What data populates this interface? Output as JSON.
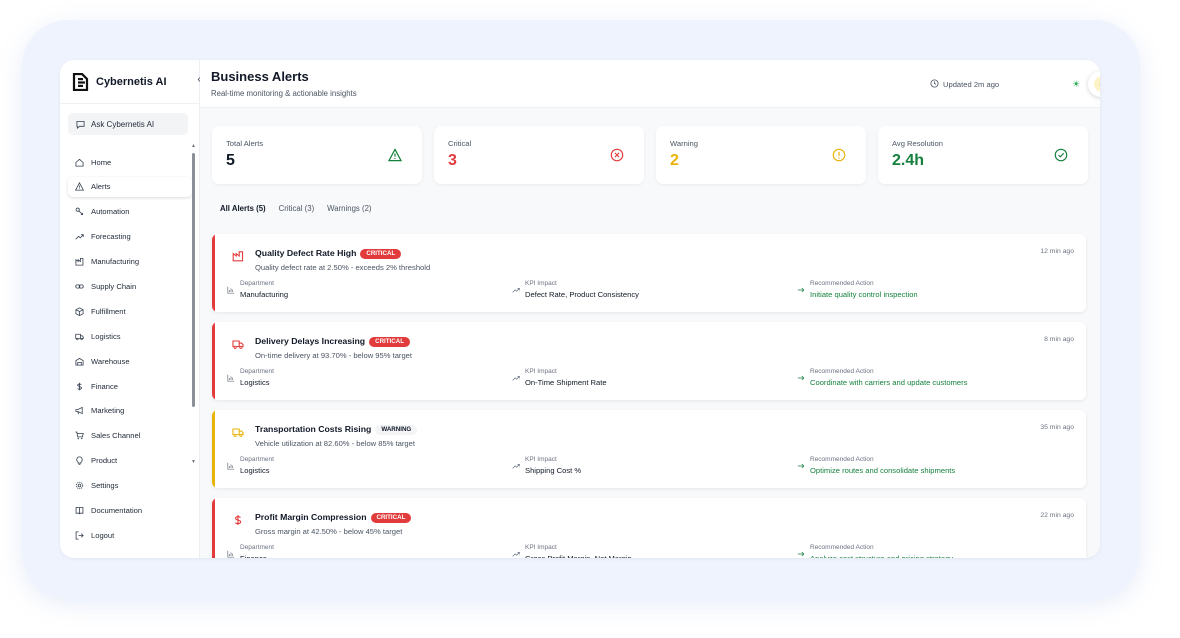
{
  "app": {
    "name": "Cybernetis AI",
    "collapse_glyph": "‹",
    "ask_label": "Ask Cybernetis AI"
  },
  "sidebar": {
    "items": [
      {
        "label": "Home",
        "icon": "home-icon",
        "active": false
      },
      {
        "label": "Alerts",
        "icon": "alert-triangle-icon",
        "active": true
      },
      {
        "label": "Automation",
        "icon": "automation-icon",
        "active": false
      },
      {
        "label": "Forecasting",
        "icon": "trending-up-icon",
        "active": false
      },
      {
        "label": "Manufacturing",
        "icon": "factory-icon",
        "active": false
      },
      {
        "label": "Supply Chain",
        "icon": "link-icon",
        "active": false
      },
      {
        "label": "Fulfillment",
        "icon": "package-icon",
        "active": false
      },
      {
        "label": "Logistics",
        "icon": "truck-icon",
        "active": false
      },
      {
        "label": "Warehouse",
        "icon": "warehouse-icon",
        "active": false
      },
      {
        "label": "Finance",
        "icon": "dollar-icon",
        "active": false
      },
      {
        "label": "Marketing",
        "icon": "megaphone-icon",
        "active": false
      },
      {
        "label": "Sales Channel",
        "icon": "cart-icon",
        "active": false
      },
      {
        "label": "Product",
        "icon": "lightbulb-icon",
        "active": false
      },
      {
        "label": "Settings",
        "icon": "gear-icon",
        "active": false
      },
      {
        "label": "Documentation",
        "icon": "book-icon",
        "active": false
      },
      {
        "label": "Logout",
        "icon": "logout-icon",
        "active": false
      }
    ]
  },
  "header": {
    "title": "Business Alerts",
    "subtitle": "Real-time monitoring & actionable insights",
    "updated": "Updated 2m ago"
  },
  "kpis": [
    {
      "label": "Total Alerts",
      "value": "5",
      "color": "#111827",
      "icon": "alert-triangle-icon",
      "icon_color": "#15803d"
    },
    {
      "label": "Critical",
      "value": "3",
      "color": "#e23b3b",
      "icon": "x-circle-icon",
      "icon_color": "#e23b3b"
    },
    {
      "label": "Warning",
      "value": "2",
      "color": "#eab308",
      "icon": "exclamation-circle-icon",
      "icon_color": "#eab308"
    },
    {
      "label": "Avg Resolution",
      "value": "2.4h",
      "color": "#15803d",
      "icon": "check-circle-icon",
      "icon_color": "#15803d"
    }
  ],
  "tabs": [
    {
      "label": "All Alerts (5)",
      "active": true
    },
    {
      "label": "Critical (3)",
      "active": false
    },
    {
      "label": "Warnings (2)",
      "active": false
    }
  ],
  "meta_labels": {
    "department": "Department",
    "kpi": "KPI Impact",
    "action": "Recommended Action"
  },
  "alerts": [
    {
      "title": "Quality Defect Rate High",
      "severity": "CRITICAL",
      "level": "critical",
      "description": "Quality defect rate at 2.50% - exceeds 2% threshold",
      "time": "12 min ago",
      "icon": "factory-icon",
      "color": "#e23b3b",
      "department": "Manufacturing",
      "kpi": "Defect Rate, Product Consistency",
      "action": "Initiate quality control inspection"
    },
    {
      "title": "Delivery Delays Increasing",
      "severity": "CRITICAL",
      "level": "critical",
      "description": "On-time delivery at 93.70% - below 95% target",
      "time": "8 min ago",
      "icon": "truck-icon",
      "color": "#e23b3b",
      "department": "Logistics",
      "kpi": "On-Time Shipment Rate",
      "action": "Coordinate with carriers and update customers"
    },
    {
      "title": "Transportation Costs Rising",
      "severity": "WARNING",
      "level": "warning",
      "description": "Vehicle utilization at 82.60% - below 85% target",
      "time": "35 min ago",
      "icon": "truck-icon",
      "color": "#eab308",
      "department": "Logistics",
      "kpi": "Shipping Cost %",
      "action": "Optimize routes and consolidate shipments"
    },
    {
      "title": "Profit Margin Compression",
      "severity": "CRITICAL",
      "level": "critical",
      "description": "Gross margin at 42.50% - below 45% target",
      "time": "22 min ago",
      "icon": "dollar-icon",
      "color": "#e23b3b",
      "department": "Finance",
      "kpi": "Gross Profit Margin, Net Margin",
      "action": "Analyze cost structure and pricing strategy"
    }
  ]
}
